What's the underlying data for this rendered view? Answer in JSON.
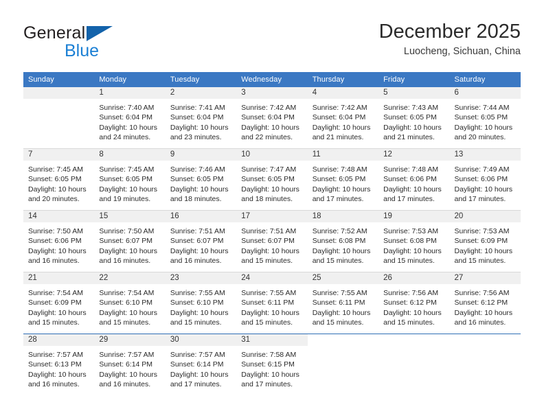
{
  "brand": {
    "name_part1": "General",
    "name_part2": "Blue",
    "accent_color": "#1a7fd4",
    "triangle_color": "#1363ab"
  },
  "header": {
    "title": "December 2025",
    "location": "Luocheng, Sichuan, China"
  },
  "calendar": {
    "header_bg": "#3b78c3",
    "daynum_bg": "#f0f0f0",
    "weekdays": [
      "Sunday",
      "Monday",
      "Tuesday",
      "Wednesday",
      "Thursday",
      "Friday",
      "Saturday"
    ],
    "weeks": [
      [
        {
          "day": "",
          "lines": []
        },
        {
          "day": "1",
          "lines": [
            "Sunrise: 7:40 AM",
            "Sunset: 6:04 PM",
            "Daylight: 10 hours",
            "and 24 minutes."
          ]
        },
        {
          "day": "2",
          "lines": [
            "Sunrise: 7:41 AM",
            "Sunset: 6:04 PM",
            "Daylight: 10 hours",
            "and 23 minutes."
          ]
        },
        {
          "day": "3",
          "lines": [
            "Sunrise: 7:42 AM",
            "Sunset: 6:04 PM",
            "Daylight: 10 hours",
            "and 22 minutes."
          ]
        },
        {
          "day": "4",
          "lines": [
            "Sunrise: 7:42 AM",
            "Sunset: 6:04 PM",
            "Daylight: 10 hours",
            "and 21 minutes."
          ]
        },
        {
          "day": "5",
          "lines": [
            "Sunrise: 7:43 AM",
            "Sunset: 6:05 PM",
            "Daylight: 10 hours",
            "and 21 minutes."
          ]
        },
        {
          "day": "6",
          "lines": [
            "Sunrise: 7:44 AM",
            "Sunset: 6:05 PM",
            "Daylight: 10 hours",
            "and 20 minutes."
          ]
        }
      ],
      [
        {
          "day": "7",
          "lines": [
            "Sunrise: 7:45 AM",
            "Sunset: 6:05 PM",
            "Daylight: 10 hours",
            "and 20 minutes."
          ]
        },
        {
          "day": "8",
          "lines": [
            "Sunrise: 7:45 AM",
            "Sunset: 6:05 PM",
            "Daylight: 10 hours",
            "and 19 minutes."
          ]
        },
        {
          "day": "9",
          "lines": [
            "Sunrise: 7:46 AM",
            "Sunset: 6:05 PM",
            "Daylight: 10 hours",
            "and 18 minutes."
          ]
        },
        {
          "day": "10",
          "lines": [
            "Sunrise: 7:47 AM",
            "Sunset: 6:05 PM",
            "Daylight: 10 hours",
            "and 18 minutes."
          ]
        },
        {
          "day": "11",
          "lines": [
            "Sunrise: 7:48 AM",
            "Sunset: 6:05 PM",
            "Daylight: 10 hours",
            "and 17 minutes."
          ]
        },
        {
          "day": "12",
          "lines": [
            "Sunrise: 7:48 AM",
            "Sunset: 6:06 PM",
            "Daylight: 10 hours",
            "and 17 minutes."
          ]
        },
        {
          "day": "13",
          "lines": [
            "Sunrise: 7:49 AM",
            "Sunset: 6:06 PM",
            "Daylight: 10 hours",
            "and 17 minutes."
          ]
        }
      ],
      [
        {
          "day": "14",
          "lines": [
            "Sunrise: 7:50 AM",
            "Sunset: 6:06 PM",
            "Daylight: 10 hours",
            "and 16 minutes."
          ]
        },
        {
          "day": "15",
          "lines": [
            "Sunrise: 7:50 AM",
            "Sunset: 6:07 PM",
            "Daylight: 10 hours",
            "and 16 minutes."
          ]
        },
        {
          "day": "16",
          "lines": [
            "Sunrise: 7:51 AM",
            "Sunset: 6:07 PM",
            "Daylight: 10 hours",
            "and 16 minutes."
          ]
        },
        {
          "day": "17",
          "lines": [
            "Sunrise: 7:51 AM",
            "Sunset: 6:07 PM",
            "Daylight: 10 hours",
            "and 15 minutes."
          ]
        },
        {
          "day": "18",
          "lines": [
            "Sunrise: 7:52 AM",
            "Sunset: 6:08 PM",
            "Daylight: 10 hours",
            "and 15 minutes."
          ]
        },
        {
          "day": "19",
          "lines": [
            "Sunrise: 7:53 AM",
            "Sunset: 6:08 PM",
            "Daylight: 10 hours",
            "and 15 minutes."
          ]
        },
        {
          "day": "20",
          "lines": [
            "Sunrise: 7:53 AM",
            "Sunset: 6:09 PM",
            "Daylight: 10 hours",
            "and 15 minutes."
          ]
        }
      ],
      [
        {
          "day": "21",
          "lines": [
            "Sunrise: 7:54 AM",
            "Sunset: 6:09 PM",
            "Daylight: 10 hours",
            "and 15 minutes."
          ]
        },
        {
          "day": "22",
          "lines": [
            "Sunrise: 7:54 AM",
            "Sunset: 6:10 PM",
            "Daylight: 10 hours",
            "and 15 minutes."
          ]
        },
        {
          "day": "23",
          "lines": [
            "Sunrise: 7:55 AM",
            "Sunset: 6:10 PM",
            "Daylight: 10 hours",
            "and 15 minutes."
          ]
        },
        {
          "day": "24",
          "lines": [
            "Sunrise: 7:55 AM",
            "Sunset: 6:11 PM",
            "Daylight: 10 hours",
            "and 15 minutes."
          ]
        },
        {
          "day": "25",
          "lines": [
            "Sunrise: 7:55 AM",
            "Sunset: 6:11 PM",
            "Daylight: 10 hours",
            "and 15 minutes."
          ]
        },
        {
          "day": "26",
          "lines": [
            "Sunrise: 7:56 AM",
            "Sunset: 6:12 PM",
            "Daylight: 10 hours",
            "and 15 minutes."
          ]
        },
        {
          "day": "27",
          "lines": [
            "Sunrise: 7:56 AM",
            "Sunset: 6:12 PM",
            "Daylight: 10 hours",
            "and 16 minutes."
          ]
        }
      ],
      [
        {
          "day": "28",
          "lines": [
            "Sunrise: 7:57 AM",
            "Sunset: 6:13 PM",
            "Daylight: 10 hours",
            "and 16 minutes."
          ]
        },
        {
          "day": "29",
          "lines": [
            "Sunrise: 7:57 AM",
            "Sunset: 6:14 PM",
            "Daylight: 10 hours",
            "and 16 minutes."
          ]
        },
        {
          "day": "30",
          "lines": [
            "Sunrise: 7:57 AM",
            "Sunset: 6:14 PM",
            "Daylight: 10 hours",
            "and 17 minutes."
          ]
        },
        {
          "day": "31",
          "lines": [
            "Sunrise: 7:58 AM",
            "Sunset: 6:15 PM",
            "Daylight: 10 hours",
            "and 17 minutes."
          ]
        },
        {
          "day": "",
          "lines": []
        },
        {
          "day": "",
          "lines": []
        },
        {
          "day": "",
          "lines": []
        }
      ]
    ]
  }
}
